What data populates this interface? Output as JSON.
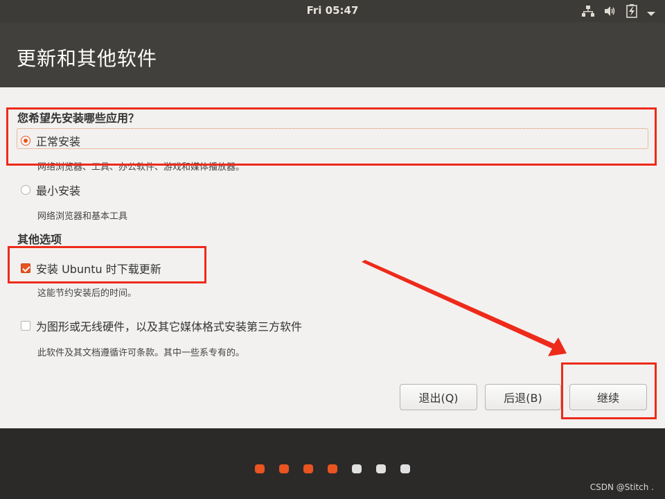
{
  "topbar": {
    "clock": "Fri 05:47",
    "icons": [
      "network-icon",
      "volume-icon",
      "battery-icon",
      "menu-arrow-icon"
    ]
  },
  "window": {
    "title": "更新和其他软件"
  },
  "install_type": {
    "heading": "您希望先安装哪些应用？",
    "options": [
      {
        "label": "正常安装",
        "desc": "网络浏览器、工具、办公软件、游戏和媒体播放器。",
        "selected": true
      },
      {
        "label": "最小安装",
        "desc": "网络浏览器和基本工具",
        "selected": false
      }
    ]
  },
  "other_options": {
    "heading": "其他选项",
    "items": [
      {
        "label": "安装 Ubuntu 时下载更新",
        "desc": "这能节约安装后的时间。",
        "checked": true
      },
      {
        "label": "为图形或无线硬件，以及其它媒体格式安装第三方软件",
        "desc": "此软件及其文档遵循许可条款。其中一些系专有的。",
        "checked": false
      }
    ]
  },
  "buttons": {
    "quit": "退出(Q)",
    "back": "后退(B)",
    "continue": "继续"
  },
  "progress": {
    "total_steps": 7,
    "completed_steps": 4
  },
  "watermark": "CSDN @Stitch .",
  "colors": {
    "accent": "#e95420",
    "annotation": "#ee2a1a"
  }
}
